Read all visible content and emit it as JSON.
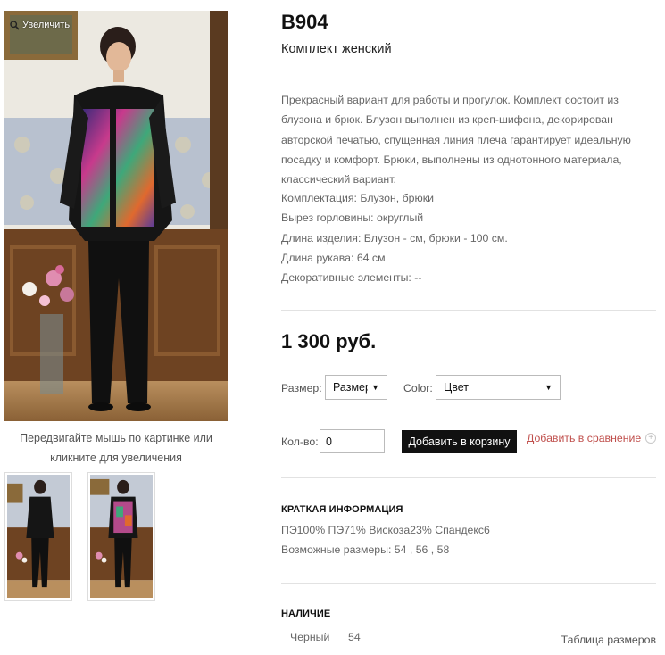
{
  "gallery": {
    "zoom_label": "Увеличить",
    "hint": "Передвигайте мышь по картинке или кликните для увеличения"
  },
  "product": {
    "sku": "B904",
    "name": "Комплект женский",
    "description": "Прекрасный вариант для работы и прогулок. Комплект состоит из блузона и брюк. Блузон выполнен из креп-шифона, декорирован авторской печатью, спущенная линия плеча гарантирует идеальную посадку и комфорт. Брюки, выполнены из однотонного материала, классический вариант.",
    "specs": [
      "Комплектация: Блузон, брюки",
      "Вырез горловины: округлый",
      "Длина изделия: Блузон - см, брюки - 100 см.",
      "Длина рукава: 64 см",
      "Декоративные элементы: --"
    ],
    "price": "1 300 руб."
  },
  "options": {
    "size_label": "Размер:",
    "size_value": "Размер",
    "color_label": "Color:",
    "color_value": "Цвет"
  },
  "cart": {
    "qty_label": "Кол-во:",
    "qty_value": "0",
    "add_to_cart": "Добавить в корзину",
    "add_to_compare": "Добавить в сравнение"
  },
  "brief": {
    "heading": "КРАТКАЯ ИНФОРМАЦИЯ",
    "composition": "ПЭ100% ПЭ71% Вискоза23% Спандекс6",
    "sizes": "Возможные размеры: 54 , 56 , 58"
  },
  "availability": {
    "heading": "НАЛИЧИЕ",
    "color": "Черный",
    "size": "54",
    "size_table_link": "Таблица размеров"
  },
  "colors": {
    "compare_link": "#c0504d",
    "button_bg": "#111111"
  }
}
